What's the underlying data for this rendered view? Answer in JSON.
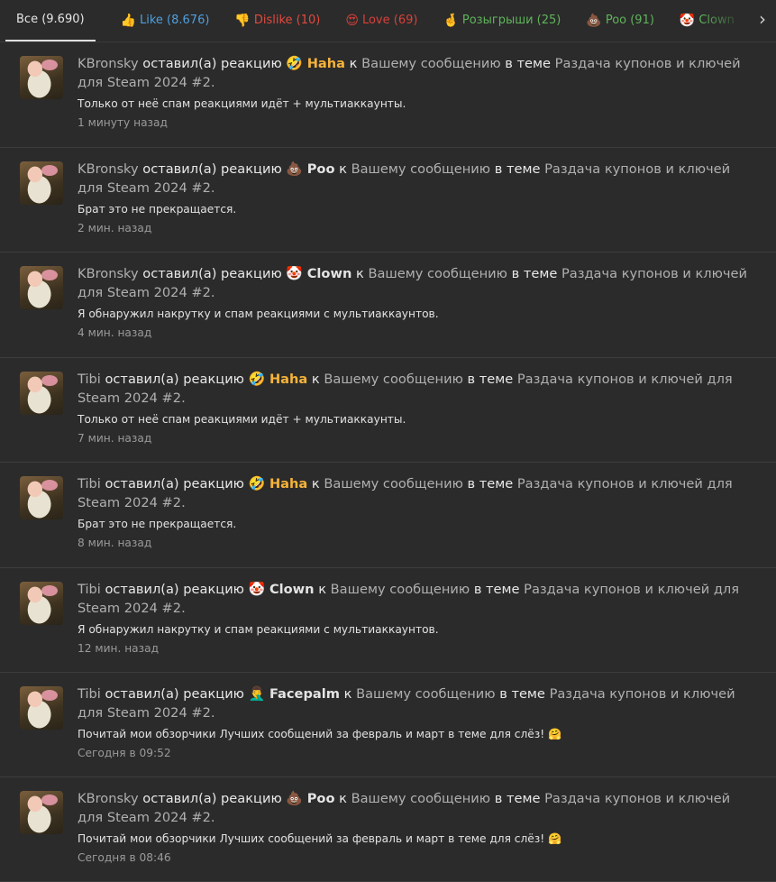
{
  "tabs": [
    {
      "label": "Все (9.690)",
      "emoji": "",
      "color": "#e6e6e6",
      "name": "tab-all"
    },
    {
      "label": "Like (8.676)",
      "emoji": "👍",
      "color": "#4f9fde",
      "name": "tab-like"
    },
    {
      "label": "Dislike (10)",
      "emoji": "👎",
      "color": "#e04a3f",
      "name": "tab-dislike"
    },
    {
      "label": "Love (69)",
      "emoji": "😍",
      "color": "#d9413a",
      "name": "tab-love"
    },
    {
      "label": "Розыгрыши (25)",
      "emoji": "🤞",
      "color": "#5fb35a",
      "name": "tab-giveaways"
    },
    {
      "label": "Poo (91)",
      "emoji": "💩",
      "color": "#5fb35a",
      "name": "tab-poo"
    },
    {
      "label": "Clown",
      "emoji": "🤡",
      "color": "#5fb35a",
      "name": "tab-clown"
    }
  ],
  "next_arrow": "›",
  "text": {
    "left": "оставил(а) реакцию",
    "to": "к",
    "your_message": "Вашему сообщению",
    "in_thread": "в теме",
    "thread": "Раздача купонов и ключей для Steam 2024 #2",
    "dot": "."
  },
  "items": [
    {
      "user": "KBronsky",
      "emoji": "🤣",
      "reaction": "Haha",
      "rclass": "haha",
      "snippet": "Только от неё спам реакциями идёт + мультиаккаунты.",
      "time": "1 минуту назад",
      "height": 117
    },
    {
      "user": "KBronsky",
      "emoji": "💩",
      "reaction": "Poo",
      "rclass": "poo",
      "snippet": "Брат это не прекращается.",
      "time": "2 мин. назад",
      "height": 116
    },
    {
      "user": "KBronsky",
      "emoji": "🤡",
      "reaction": "Clown",
      "rclass": "clown",
      "snippet": "Я обнаружил накрутку и спам реакциями с мультиаккаунтов.",
      "time": "4 мин. назад",
      "height": 117
    },
    {
      "user": "Tibi",
      "emoji": "🤣",
      "reaction": "Haha",
      "rclass": "haha",
      "snippet": "Только от неё спам реакциями идёт + мультиаккаунты.",
      "time": "7 мин. назад",
      "height": 116
    },
    {
      "user": "Tibi",
      "emoji": "🤣",
      "reaction": "Haha",
      "rclass": "haha",
      "snippet": "Брат это не прекращается.",
      "time": "8 мин. назад",
      "height": 117
    },
    {
      "user": "Tibi",
      "emoji": "🤡",
      "reaction": "Clown",
      "rclass": "clown",
      "snippet": "Я обнаружил накрутку и спам реакциями с мультиаккаунтов.",
      "time": "12 мин. назад",
      "height": 116
    },
    {
      "user": "Tibi",
      "emoji": "🤦‍♂️",
      "reaction": "Facepalm",
      "rclass": "facepalm",
      "snippet": "Почитай мои обзорчики Лучших сообщений за февраль и март в теме для слёз! 🤗",
      "time": "Сегодня в 09:52",
      "height": 116
    },
    {
      "user": "KBronsky",
      "emoji": "💩",
      "reaction": "Poo",
      "rclass": "poo",
      "snippet": "Почитай мои обзорчики Лучших сообщений за февраль и март в теме для слёз! 🤗",
      "time": "Сегодня в 08:46",
      "height": 116
    }
  ]
}
